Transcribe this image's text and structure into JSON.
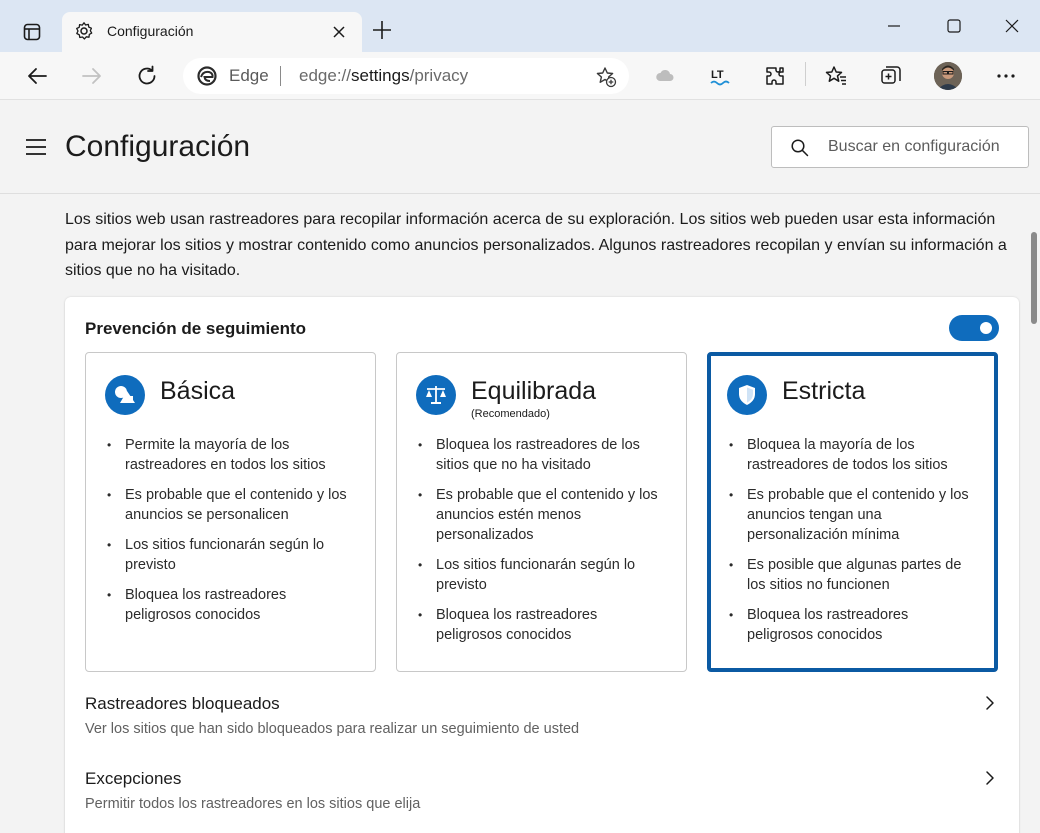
{
  "browser": {
    "tab_title": "Configuración",
    "omnibox": {
      "site_label": "Edge",
      "url_scheme": "edge://",
      "url_host": "settings",
      "url_path": "/privacy"
    },
    "toolbar_icons": [
      "back-icon",
      "forward-icon",
      "refresh-icon",
      "add-favorite-icon",
      "cloud-icon",
      "lt-extension-icon",
      "extensions-icon",
      "favorites-icon",
      "collections-icon",
      "profile-avatar",
      "more-icon"
    ],
    "accent_color": "#0f6cbd"
  },
  "header": {
    "title": "Configuración",
    "search_placeholder": "Buscar en configuración"
  },
  "intro_text": "Los sitios web usan rastreadores para recopilar información acerca de su exploración. Los sitios web pueden usar esta información para mejorar los sitios y mostrar contenido como anuncios personalizados. Algunos rastreadores recopilan y envían su información a sitios que no ha visitado.",
  "tracking": {
    "label": "Prevención de seguimiento",
    "enabled": true,
    "levels": [
      {
        "name": "Básica",
        "subtitle": "",
        "icon": "shapes-icon",
        "selected": false,
        "bullets": [
          "Permite la mayoría de los rastreadores en todos los sitios",
          "Es probable que el contenido y los anuncios se personalicen",
          "Los sitios funcionarán según lo previsto",
          "Bloquea los rastreadores peligrosos conocidos"
        ]
      },
      {
        "name": "Equilibrada",
        "subtitle": "(Recomendado)",
        "icon": "scale-icon",
        "selected": false,
        "bullets": [
          "Bloquea los rastreadores de los sitios que no ha visitado",
          "Es probable que el contenido y los anuncios estén menos personalizados",
          "Los sitios funcionarán según lo previsto",
          "Bloquea los rastreadores peligrosos conocidos"
        ]
      },
      {
        "name": "Estricta",
        "subtitle": "",
        "icon": "shield-icon",
        "selected": true,
        "bullets": [
          "Bloquea la mayoría de los rastreadores de todos los sitios",
          "Es probable que el contenido y los anuncios tengan una personalización mínima",
          "Es posible que algunas partes de los sitios no funcionen",
          "Bloquea los rastreadores peligrosos conocidos"
        ]
      }
    ]
  },
  "rows": [
    {
      "title": "Rastreadores bloqueados",
      "description": "Ver los sitios que han sido bloqueados para realizar un seguimiento de usted"
    },
    {
      "title": "Excepciones",
      "description": "Permitir todos los rastreadores en los sitios que elija"
    }
  ]
}
